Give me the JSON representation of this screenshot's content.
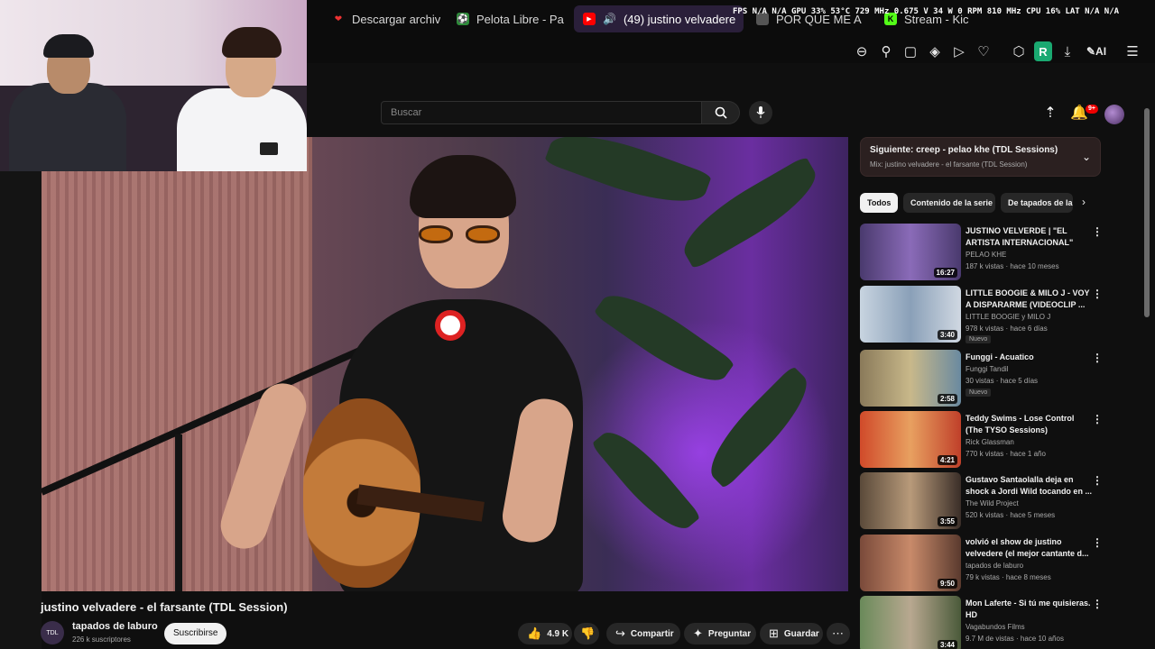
{
  "tabs": [
    {
      "label": "Descargar archiv",
      "icon": "heart-icon"
    },
    {
      "label": "Pelota Libre - Pa",
      "icon": "soccer-icon"
    },
    {
      "label": "(49) justino velvadere",
      "icon": "youtube-icon"
    },
    {
      "label": "POR QUE ME A",
      "icon": "tab-icon"
    },
    {
      "label": "Stream - Kic",
      "icon": "kick-icon"
    }
  ],
  "osd": "FPS N/A N/A   GPU 33% 53°C 729 MHz 0.675 V 34 W 0 RPM 810 MHz   CPU 16%   LAT N/A N/A",
  "toolbar": {
    "r_label": "R",
    "ai_label": "AI"
  },
  "youtube": {
    "search_placeholder": "Buscar",
    "notif_count": "9+"
  },
  "video": {
    "title": "justino velvadere - el farsante (TDL Session)",
    "channel": "tapados de laburo",
    "channel_avatar_text": "TDL",
    "subscribers": "226 k suscriptores",
    "subscribe_label": "Suscribirse",
    "likes": "4.9 K",
    "share_label": "Compartir",
    "ask_label": "Preguntar",
    "save_label": "Guardar"
  },
  "upnext": {
    "title": "Siguiente: creep - pelao khe (TDL Sessions)",
    "subtitle": "Mix: justino velvadere - el farsante (TDL Session)"
  },
  "chips": [
    "Todos",
    "Contenido de la serie",
    "De tapados de la"
  ],
  "recommendations": [
    {
      "title": "JUSTINO VELVERDE | \"EL ARTISTA INTERNACIONAL\"",
      "channel": "PELAO KHE",
      "meta": "187 k vistas · hace 10 meses",
      "duration": "16:27",
      "badge": ""
    },
    {
      "title": "LITTLE BOOGIE & MILO J - VOY A DISPARARME (VIDEOCLIP ...",
      "channel": "LITTLE BOOGIE y MILO J",
      "meta": "978 k vistas · hace 6 días",
      "duration": "3:40",
      "badge": "Nuevo"
    },
    {
      "title": "Funggi - Acuatico",
      "channel": "Funggi Tandil",
      "meta": "30 vistas · hace 5 días",
      "duration": "2:58",
      "badge": "Nuevo"
    },
    {
      "title": "Teddy Swims - Lose Control (The TYSO Sessions)",
      "channel": "Rick Glassman",
      "meta": "770 k vistas · hace 1 año",
      "duration": "4:21",
      "badge": ""
    },
    {
      "title": "Gustavo Santaolalla deja en shock a Jordi Wild tocando en ...",
      "channel": "The Wild Project",
      "meta": "520 k vistas · hace 5 meses",
      "duration": "3:55",
      "badge": ""
    },
    {
      "title": "volvió el show de justino velvedere (el mejor cantante d...",
      "channel": "tapados de laburo",
      "meta": "79 k vistas · hace 8 meses",
      "duration": "9:50",
      "badge": ""
    },
    {
      "title": "Mon Laferte - Si tú me quisieras. HD",
      "channel": "Vagabundos Films",
      "meta": "9.7 M de vistas · hace 10 años",
      "duration": "3:44",
      "badge": ""
    }
  ],
  "colors": {
    "accent_red": "#ff0000",
    "bg": "#0f0f0f",
    "tab_active": "#2a1f3a",
    "r_ext": "#1aa971"
  }
}
